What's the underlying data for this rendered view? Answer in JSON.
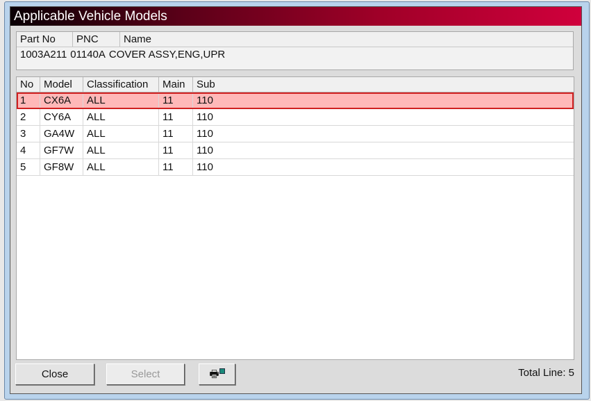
{
  "dialog": {
    "title": "Applicable Vehicle Models"
  },
  "part": {
    "headers": [
      "Part No",
      "PNC",
      "Name"
    ],
    "values": [
      "1003A211",
      "01140A",
      "COVER ASSY,ENG,UPR"
    ]
  },
  "grid": {
    "headers": [
      "No",
      "Model",
      "Classification",
      "Main",
      "Sub"
    ],
    "rows": [
      [
        "1",
        "CX6A",
        "ALL",
        "11",
        "110"
      ],
      [
        "2",
        "CY6A",
        "ALL",
        "11",
        "110"
      ],
      [
        "3",
        "GA4W",
        "ALL",
        "11",
        "110"
      ],
      [
        "4",
        "GF7W",
        "ALL",
        "11",
        "110"
      ],
      [
        "5",
        "GF8W",
        "ALL",
        "11",
        "110"
      ]
    ],
    "selected_row": 1
  },
  "buttons": {
    "close": "Close",
    "select": "Select",
    "print_icon": "printer-icon"
  },
  "status": {
    "total_line": "Total Line: 5"
  },
  "colors": {
    "selected_row": "#ffb8b8",
    "selected_border": "#d02020"
  }
}
